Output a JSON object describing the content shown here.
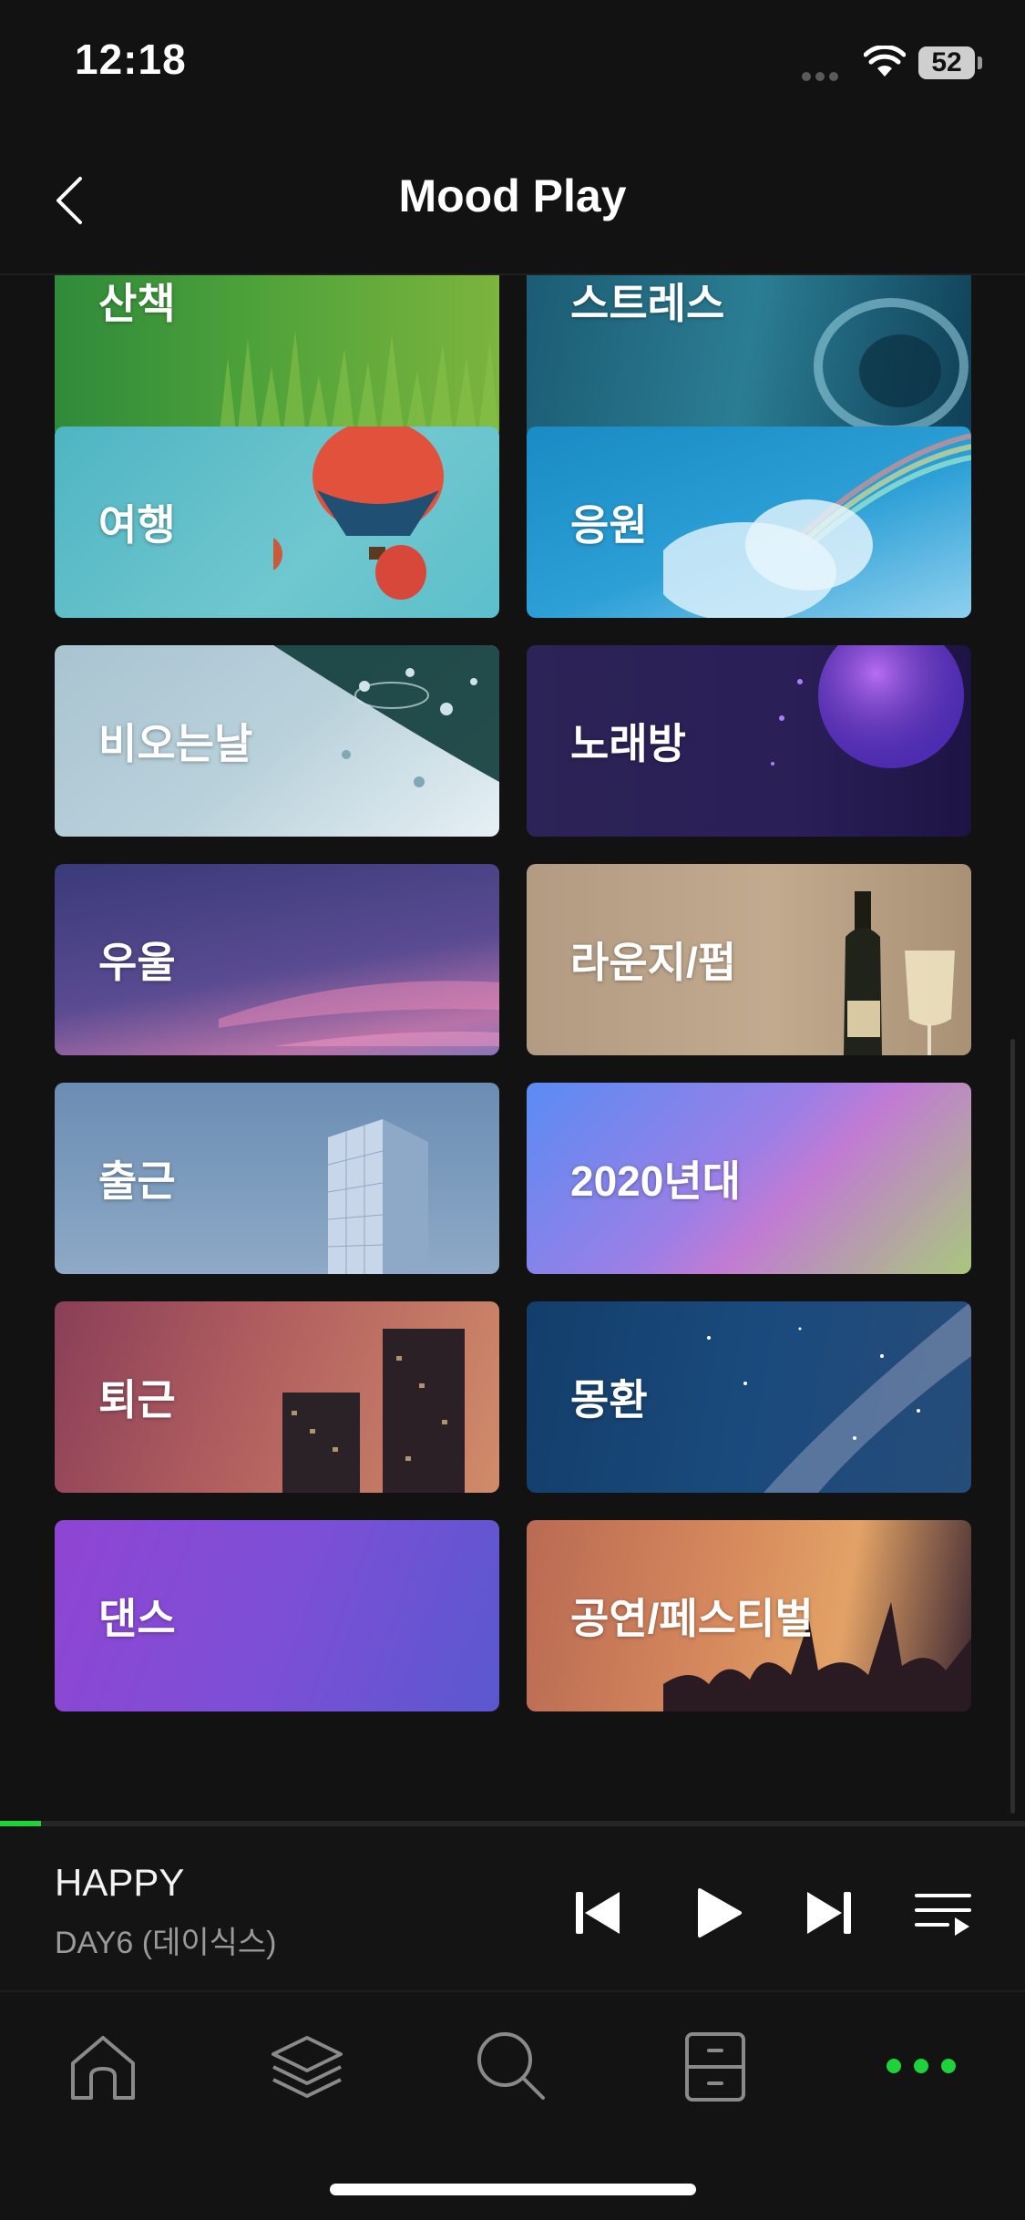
{
  "status": {
    "time": "12:18",
    "battery": "52"
  },
  "header": {
    "title": "Mood Play"
  },
  "tiles": [
    {
      "label": "산책",
      "bg": "linear-gradient(90deg,#2f8a3a 0%,#4ea23a 45%,#7cb43e 100%)"
    },
    {
      "label": "스트레스",
      "bg": "linear-gradient(100deg,#1b5b73 0%,#2b7d93 50%,#0f3f57 100%)"
    },
    {
      "label": "여행",
      "bg": "linear-gradient(135deg,#4fb5c2 0%,#6fc7cf 60%,#5cbfcb 100%)"
    },
    {
      "label": "응원",
      "bg": "linear-gradient(160deg,#1a8bc4 0%,#2b9fd6 55%,#8fd0ee 100%)"
    },
    {
      "label": "비오는날",
      "bg": "linear-gradient(140deg,#a9c4d0 0%,#b9d1db 50%,#e6f0f4 100%)"
    },
    {
      "label": "노래방",
      "bg": "linear-gradient(90deg,#2c2356 0%,#2a1f57 60%,#1d1444 100%)"
    },
    {
      "label": "우울",
      "bg": "linear-gradient(170deg,#3a3a7a 0%,#5a4b92 55%,#b773a8 85%,#8a74b6 100%)"
    },
    {
      "label": "라운지/펍",
      "bg": "linear-gradient(90deg,#b29b82 0%,#c2aa8f 55%,#a99176 100%)"
    },
    {
      "label": "출근",
      "bg": "linear-gradient(180deg,#6c8db3 0%,#7f9ebf 60%,#8fa9c6 100%)"
    },
    {
      "label": "2020년대",
      "bg": "linear-gradient(135deg,#5a8cf3 0%,#9a7fe6 45%,#c17bd4 60%,#a9c77c 100%)"
    },
    {
      "label": "퇴근",
      "bg": "linear-gradient(110deg,#8a3f58 0%,#b25f5f 45%,#d08c6a 100%)"
    },
    {
      "label": "몽환",
      "bg": "linear-gradient(100deg,#123e6a 0%,#1a4a7d 50%,#264c79 100%)"
    },
    {
      "label": "댄스",
      "bg": "linear-gradient(110deg,#8f45d2 0%,#7d4fd6 50%,#5a58cf 100%)"
    },
    {
      "label": "공연/페스티벌",
      "bg": "linear-gradient(100deg,#b96a53 0%,#d78a5d 45%,#e2a266 70%,#3a2531 100%)"
    }
  ],
  "player": {
    "title": "HAPPY",
    "artist": "DAY6 (데이식스)",
    "progress": 0.04
  },
  "colors": {
    "accent": "#1ed33a",
    "background": "#121212"
  },
  "icons": [
    "chevron-left-icon",
    "previous-icon",
    "play-icon",
    "next-icon",
    "playlist-icon",
    "home-icon",
    "layers-icon",
    "search-icon",
    "library-icon",
    "more-icon"
  ]
}
